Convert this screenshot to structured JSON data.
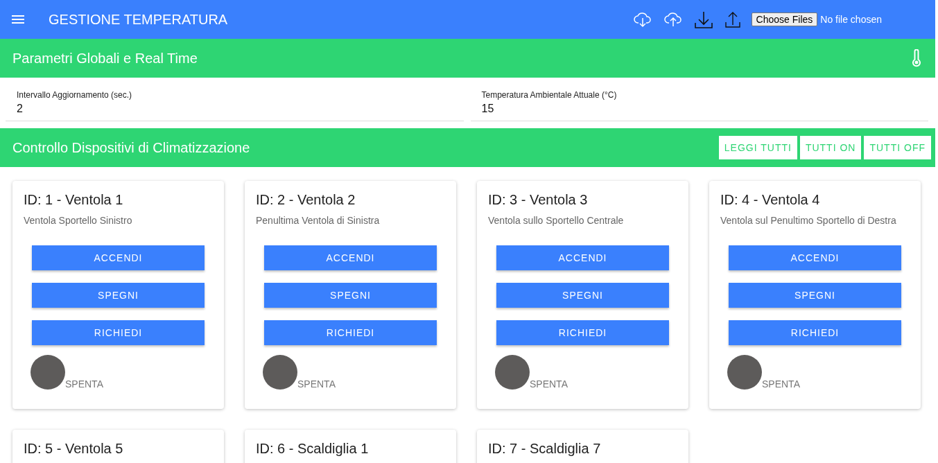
{
  "app_bar": {
    "title": "GESTIONE TEMPERATURA",
    "file_button": "Choose Files",
    "file_status": "No file chosen"
  },
  "global_section": {
    "title": "Parametri Globali e Real Time",
    "fields": [
      {
        "label": "Intervallo Aggiornamento (sec.)",
        "value": "2"
      },
      {
        "label": "Temperatura Ambientale Attuale (°C)",
        "value": "15"
      }
    ]
  },
  "devices_section": {
    "title": "Controllo Dispositivi di Climatizzazione",
    "actions": [
      "LEGGI TUTTI",
      "TUTTI ON",
      "TUTTI OFF"
    ]
  },
  "devices": [
    {
      "title": "ID: 1 - Ventola 1",
      "description": "Ventola Sportello Sinistro",
      "buttons": [
        "ACCENDI",
        "SPEGNI",
        "RICHIEDI"
      ],
      "on": false,
      "status": "SPENTA"
    },
    {
      "title": "ID: 2 - Ventola 2",
      "description": "Penultima Ventola di Sinistra",
      "buttons": [
        "ACCENDI",
        "SPEGNI",
        "RICHIEDI"
      ],
      "on": false,
      "status": "SPENTA"
    },
    {
      "title": "ID: 3 - Ventola 3",
      "description": "Ventola sullo Sportello Centrale",
      "buttons": [
        "ACCENDI",
        "SPEGNI",
        "RICHIEDI"
      ],
      "on": false,
      "status": "SPENTA"
    },
    {
      "title": "ID: 4 - Ventola 4",
      "description": "Ventola sul Penultimo Sportello di Destra",
      "buttons": [
        "ACCENDI",
        "SPEGNI",
        "RICHIEDI"
      ],
      "on": false,
      "status": "SPENTA"
    },
    {
      "title": "ID: 5 - Ventola 5"
    },
    {
      "title": "ID: 6 - Scaldiglia 1"
    },
    {
      "title": "ID: 7 - Scaldiglia 7"
    }
  ]
}
